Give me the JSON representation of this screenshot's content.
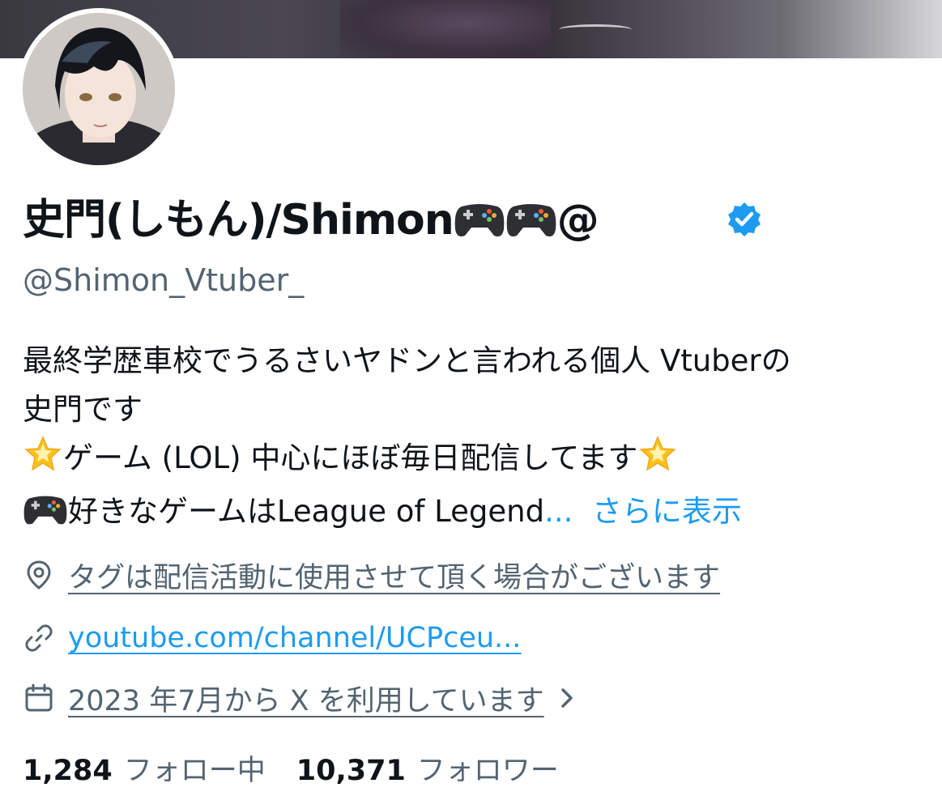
{
  "profile": {
    "display_name": "史門(しもん)/Shimon",
    "display_name_suffix": "@",
    "handle": "@Shimon_Vtuber_",
    "verified_icon": "verified-badge-icon"
  },
  "bio": {
    "line1": "最終学歴車校でうるさいヤドンと言われる個人 Vtuberの",
    "line2": "史門です",
    "line3": "ゲーム (LOL) 中心にほぼ毎日配信してます",
    "line4": "好きなゲームはLeague of Legend",
    "line4_ellipsis": "...",
    "show_more": "さらに表示"
  },
  "meta": {
    "location": "タグは配信活動に使用させて頂く場合がございます",
    "location_icon": "location-pin-icon",
    "website": "youtube.com/channel/UCPceu...",
    "website_icon": "link-icon",
    "joined": "2023 年7月から X を利用しています",
    "joined_icon": "calendar-icon"
  },
  "stats": {
    "following_count": "1,284",
    "following_label": "フォロー中",
    "followers_count": "10,371",
    "followers_label": "フォロワー"
  },
  "colors": {
    "text": "#0f1419",
    "secondary": "#536471",
    "link": "#1d9bf0"
  }
}
